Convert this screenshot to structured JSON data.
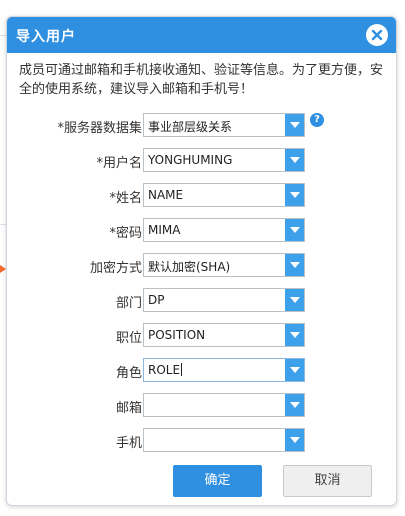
{
  "dialog": {
    "title": "导入用户",
    "notice": "成员可通过邮箱和手机接收通知、验证等信息。为了更方便，安全的使用系统，建议导入邮箱和手机号！",
    "help_glyph": "?",
    "fields": [
      {
        "label": "*服务器数据集",
        "value": "事业部层级关系"
      },
      {
        "label": "*用户名",
        "value": "YONGHUMING"
      },
      {
        "label": "*姓名",
        "value": "NAME"
      },
      {
        "label": "*密码",
        "value": "MIMA"
      },
      {
        "label": "加密方式",
        "value": "默认加密(SHA)"
      },
      {
        "label": "部门",
        "value": "DP"
      },
      {
        "label": "职位",
        "value": "POSITION"
      },
      {
        "label": "角色",
        "value": "ROLE"
      },
      {
        "label": "邮箱",
        "value": ""
      },
      {
        "label": "手机",
        "value": ""
      }
    ],
    "buttons": {
      "ok": "确定",
      "cancel": "取消"
    }
  },
  "colors": {
    "accent": "#2f8fe0",
    "dropdown_arrow": "#3da0ea",
    "background_marker": "#f26a2c"
  }
}
